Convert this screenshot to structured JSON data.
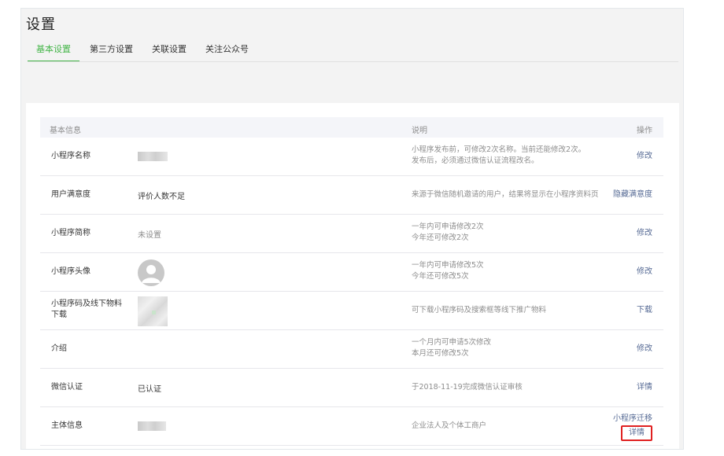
{
  "header": {
    "title": "设置",
    "tabs": [
      {
        "label": "基本设置",
        "active": true
      },
      {
        "label": "第三方设置",
        "active": false
      },
      {
        "label": "关联设置",
        "active": false
      },
      {
        "label": "关注公众号",
        "active": false
      }
    ]
  },
  "table": {
    "headers": {
      "basic": "基本信息",
      "desc": "说明",
      "op": "操作"
    },
    "rows": [
      {
        "label": "小程序名称",
        "value": "",
        "desc1": "小程序发布前，可修改2次名称。当前还能修改2次。",
        "desc2": "发布后，必须通过微信认证流程改名。",
        "op": "修改"
      },
      {
        "label": "用户满意度",
        "value": "评价人数不足",
        "desc1": "来源于微信随机邀请的用户，结果将显示在小程序资料页",
        "desc2": "",
        "op": "隐藏满意度"
      },
      {
        "label": "小程序简称",
        "value": "未设置",
        "desc1": "一年内可申请修改2次",
        "desc2": "今年还可修改2次",
        "op": "修改"
      },
      {
        "label": "小程序头像",
        "value": "",
        "desc1": "一年内可申请修改5次",
        "desc2": "今年还可修改5次",
        "op": "修改"
      },
      {
        "label": "小程序码及线下物料下载",
        "value": "",
        "desc1": "可下载小程序码及搜索框等线下推广物料",
        "desc2": "",
        "op": "下载"
      },
      {
        "label": "介绍",
        "value": "",
        "desc1": "一个月内可申请5次修改",
        "desc2": "本月还可修改5次",
        "op": "修改"
      },
      {
        "label": "微信认证",
        "value": "已认证",
        "desc1": "于2018-11-19完成微信认证审核",
        "desc2": "",
        "op": "详情"
      },
      {
        "label": "主体信息",
        "value": "",
        "desc1": "企业法人及个体工商户",
        "desc2": "",
        "op": "小程序迁移",
        "op2": "详情"
      }
    ]
  },
  "colors": {
    "accent": "#44b549",
    "link": "#576b95",
    "highlight": "#e02020"
  }
}
